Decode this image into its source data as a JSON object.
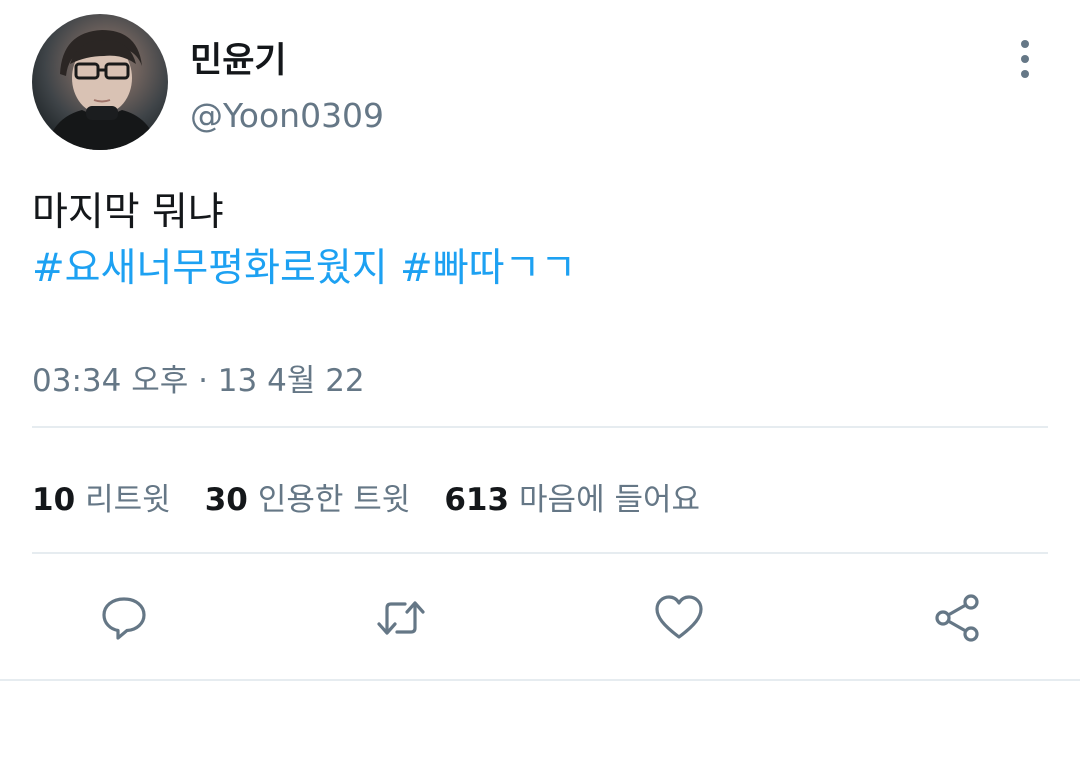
{
  "user": {
    "display_name": "민윤기",
    "handle": "@Yoon0309"
  },
  "tweet": {
    "text": "마지막 뭐냐",
    "hashtags": [
      "#요새너무평화로웠지",
      "#빠따ㄱㄱ"
    ],
    "timestamp": "03:34 오후 · 13 4월 22"
  },
  "stats": {
    "retweets": {
      "count": "10",
      "label": "리트윗"
    },
    "quotes": {
      "count": "30",
      "label": "인용한 트윗"
    },
    "likes": {
      "count": "613",
      "label": "마음에 들어요"
    }
  },
  "actions": [
    "reply-icon",
    "retweet-icon",
    "like-icon",
    "share-icon"
  ],
  "colors": {
    "hashtag": "#1da1f2",
    "secondary_text": "#657786",
    "primary_text": "#14171a",
    "divider": "#e6ecf0"
  }
}
